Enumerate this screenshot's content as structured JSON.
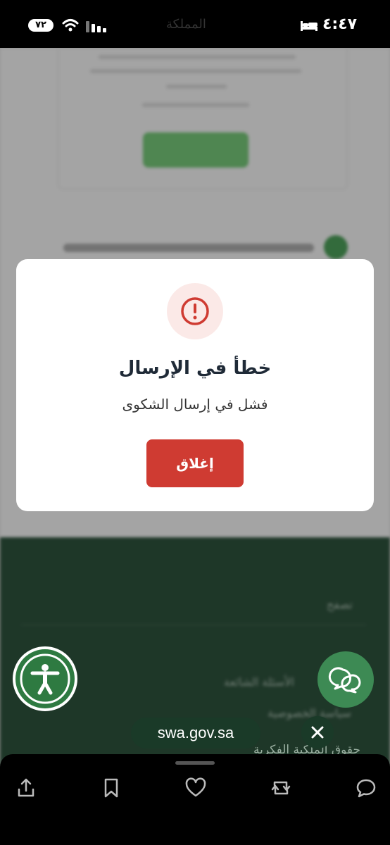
{
  "status_bar": {
    "battery": "٧٢",
    "time": "٤:٤٧",
    "background_text": "المملكة"
  },
  "background": {
    "footer_items": [
      "تصفح",
      "الأسئلة الشائعة",
      "سياسة الخصوصية"
    ],
    "footer_bottom": "حقوق الملكية الفكرية"
  },
  "modal": {
    "title": "خطأ في الإرسال",
    "message": "فشل في إرسال الشكوى",
    "close_label": "إغلاق",
    "accent_color": "#cf3b32"
  },
  "browser": {
    "url": "swa.gov.sa"
  },
  "toolbar": {
    "icons": [
      "share-icon",
      "bookmark-icon",
      "heart-icon",
      "repost-icon",
      "comment-icon"
    ]
  }
}
